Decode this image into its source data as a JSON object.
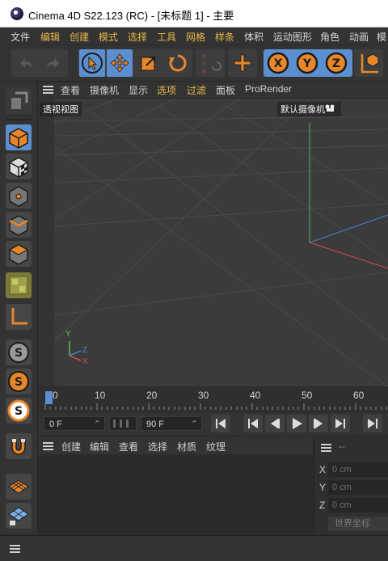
{
  "window": {
    "title": "Cinema 4D S22.123 (RC) - [未标题 1] - 主要"
  },
  "menu": [
    "文件",
    "编辑",
    "创建",
    "模式",
    "选择",
    "工具",
    "网格",
    "样条",
    "体积",
    "运动图形",
    "角色",
    "动画",
    "模"
  ],
  "viewport": {
    "menu": [
      "查看",
      "摄像机",
      "显示",
      "选项",
      "过滤",
      "面板",
      "ProRender"
    ],
    "view_name": "透视视图",
    "camera_label": "默认摄像机",
    "axis": {
      "y": "Y",
      "z": "Z",
      "x": "X"
    }
  },
  "timeline": {
    "ticks": [
      "0",
      "10",
      "20",
      "30",
      "40",
      "50",
      "60"
    ]
  },
  "transport": {
    "start": "0 F",
    "end": "90 F"
  },
  "material_manager": {
    "menu": [
      "创建",
      "编辑",
      "查看",
      "选择",
      "材质",
      "纹理"
    ]
  },
  "coordinates": {
    "header": "--",
    "rows": [
      {
        "axis": "X",
        "value": "0 cm"
      },
      {
        "axis": "Y",
        "value": "0 cm"
      },
      {
        "axis": "Z",
        "value": "0 cm"
      }
    ],
    "world_button": "世界坐标"
  },
  "colors": {
    "accent": "#5b8fcf",
    "orange": "#e8862a",
    "axis_x": "#d04a4a",
    "axis_y": "#4ac25a",
    "axis_z": "#4a7fd0"
  }
}
